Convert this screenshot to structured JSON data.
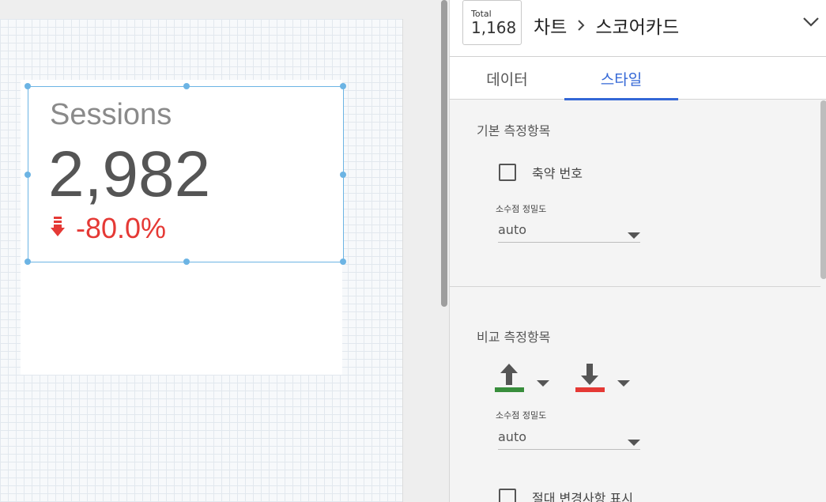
{
  "scorecard": {
    "label": "Sessions",
    "value": "2,982",
    "change": "-80.0%",
    "change_color": "#e53935"
  },
  "header": {
    "total_label": "Total",
    "total_value": "1,168",
    "breadcrumb": [
      "차트",
      "스코어카드"
    ]
  },
  "tabs": [
    {
      "label": "데이터",
      "active": false
    },
    {
      "label": "스타일",
      "active": true
    }
  ],
  "primary_metric": {
    "title": "기본 측정항목",
    "compact_numbers_label": "축약 번호",
    "compact_numbers_checked": false,
    "precision_label": "소수점 정밀도",
    "precision_value": "auto"
  },
  "comparison_metric": {
    "title": "비교 측정항목",
    "positive_color": "#388e3c",
    "negative_color": "#e53935",
    "precision_label": "소수점 정밀도",
    "precision_value": "auto",
    "absolute_change_label": "절대 변경사항 표시",
    "absolute_change_checked": false
  },
  "colors": {
    "accent": "#3367d6",
    "selection": "#6cb4e4"
  }
}
